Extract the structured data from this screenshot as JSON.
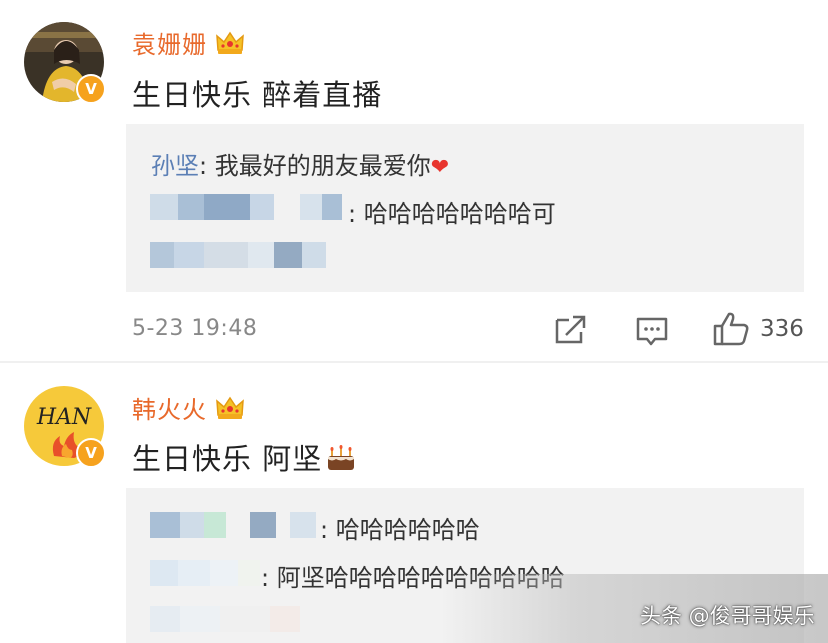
{
  "comments": [
    {
      "username": "袁姗姗",
      "text": "生日快乐 醉着直播",
      "replies": [
        {
          "user": "孙坚",
          "sep": ": ",
          "text": "我最好的朋友最爱你",
          "emoji": "❤"
        },
        {
          "user_obscured": true,
          "sep": ": ",
          "text": "哈哈哈哈哈哈哈可"
        }
      ],
      "more_obscured": true,
      "time": "5-23 19:48",
      "likes": "336"
    },
    {
      "username": "韩火火",
      "avatar_text": "HAN",
      "text": "生日快乐 阿坚",
      "replies": [
        {
          "user_obscured": true,
          "sep": ": ",
          "text": "哈哈哈哈哈哈"
        },
        {
          "user_obscured": true,
          "sep": ": ",
          "text": "阿坚哈哈哈哈哈哈哈哈哈哈"
        }
      ]
    }
  ],
  "badges": {
    "verified": "V"
  },
  "icons": [
    "crown-icon",
    "verified-icon",
    "forward-icon",
    "comment-icon",
    "like-icon",
    "cake-icon",
    "heart-icon"
  ],
  "colors": {
    "username": "#e8692b",
    "reply_user": "#5b7fb5",
    "reply_bg": "#f2f2f2",
    "badge": "#f6a21e"
  },
  "watermark": "头条 @俊哥哥娱乐"
}
